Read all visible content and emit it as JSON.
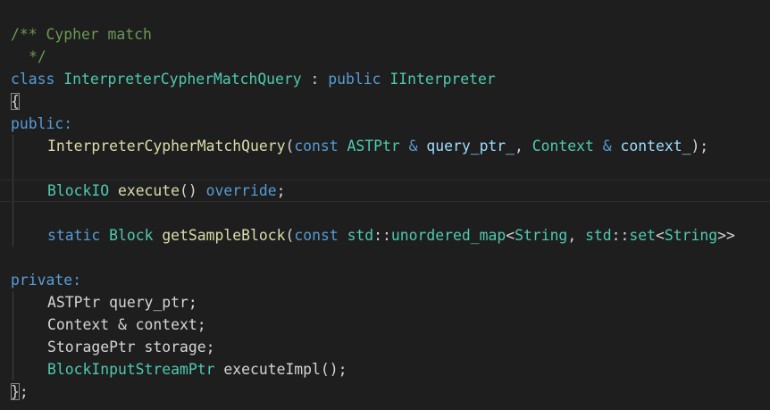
{
  "code": {
    "comment_open": "/** Cypher match",
    "comment_close": "*/",
    "kw_class": "class",
    "class_name": "InterpreterCypherMatchQuery",
    "colon": " : ",
    "kw_public_inherit": "public",
    "base_class": "IInterpreter",
    "open_brace": "{",
    "access_public": "public:",
    "ctor_name": "InterpreterCypherMatchQuery",
    "paren_open": "(",
    "kw_const_1": "const",
    "ast_ptr_type": "ASTPtr",
    "amp_1": " & ",
    "param_query_ptr": "query_ptr_",
    "comma_1": ", ",
    "context_type": "Context",
    "amp_2": " & ",
    "param_context": "context_",
    "ctor_end": ");",
    "block_io_type": "BlockIO",
    "execute_fn": "execute",
    "empty_parens": "()",
    "kw_override": "override",
    "semicolon": ";",
    "kw_static": "static",
    "block_type": "Block",
    "get_sample_block_fn": "getSampleBlock",
    "kw_const_2": "const",
    "std_1": "std",
    "scope_1": "::",
    "unordered_map_type": "unordered_map",
    "lt_1": "<",
    "string_type_1": "String",
    "comma_2": ", ",
    "std_2": "std",
    "scope_2": "::",
    "set_type": "set",
    "lt_2": "<",
    "string_type_2": "String",
    "gt_gt": ">>",
    "access_private": "private:",
    "member_ast_ptr": "ASTPtr",
    "member_query_ptr": " query_ptr;",
    "member_context_decl": "Context & context;",
    "member_storage_decl": "StoragePtr storage;",
    "stream_type": "BlockInputStreamPtr",
    "execute_impl_decl": " executeImpl();",
    "close_brace": "}",
    "close_semicolon": ";"
  }
}
